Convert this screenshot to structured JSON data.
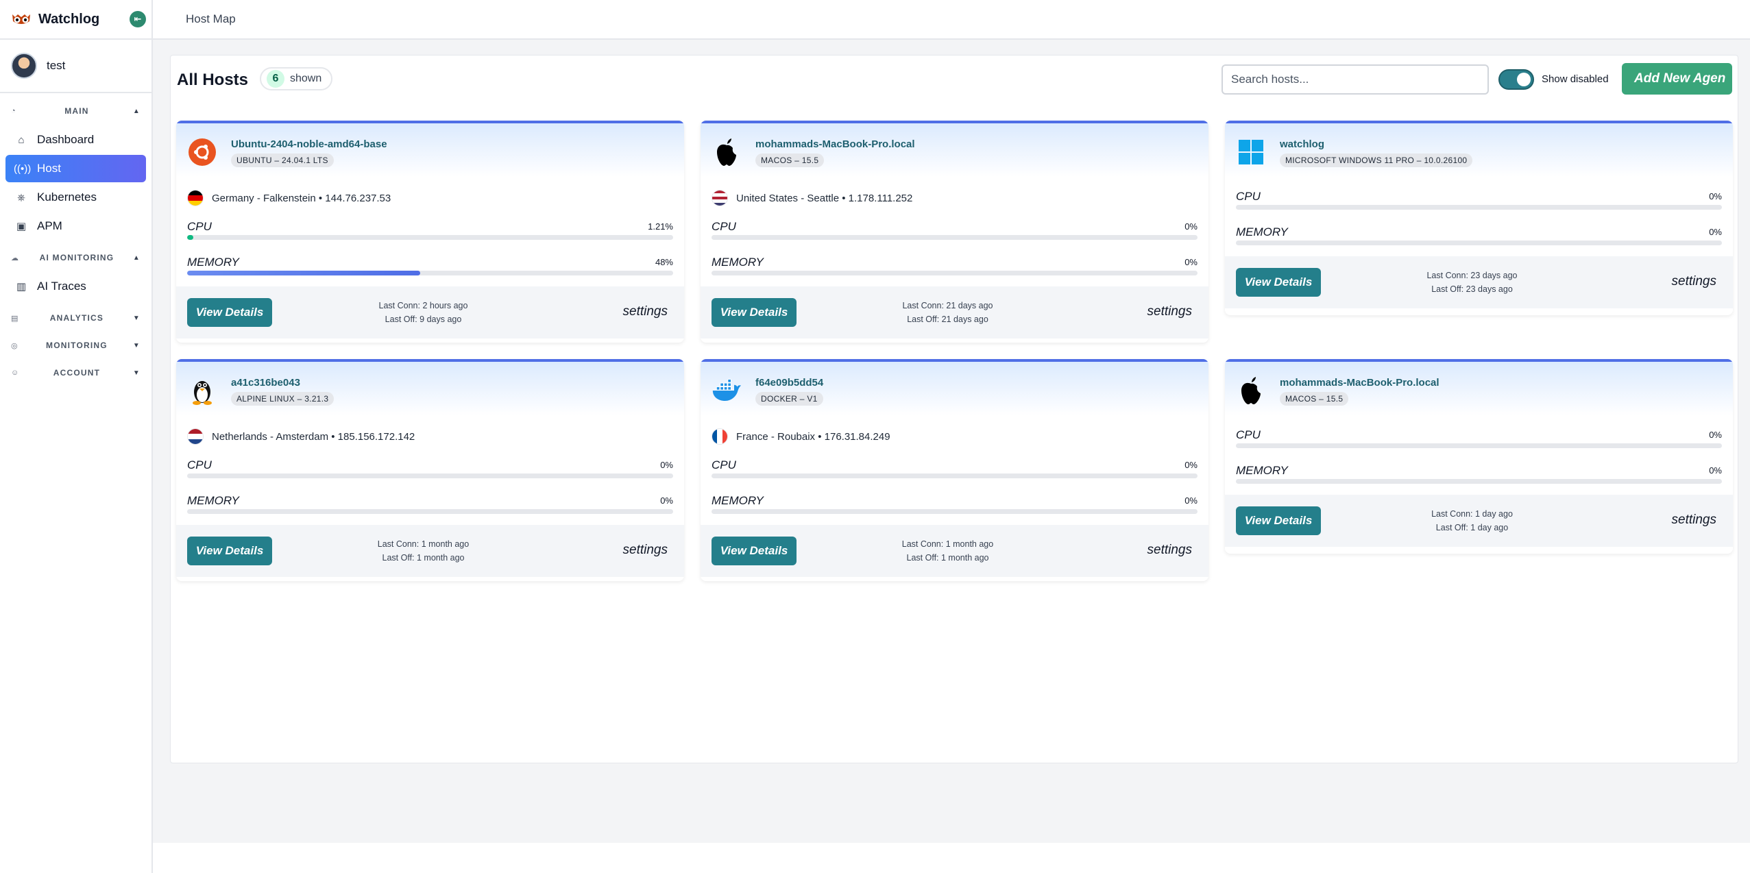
{
  "app": {
    "name": "Watchlog",
    "user": "test"
  },
  "sidebar": {
    "sections": [
      {
        "title": "MAIN",
        "items": [
          {
            "label": "Dashboard"
          },
          {
            "label": "Host"
          },
          {
            "label": "Kubernetes"
          },
          {
            "label": "APM"
          }
        ]
      },
      {
        "title": "AI MONITORING",
        "items": [
          {
            "label": "AI Traces"
          }
        ]
      },
      {
        "title": "ANALYTICS",
        "items": []
      },
      {
        "title": "MONITORING",
        "items": []
      },
      {
        "title": "ACCOUNT",
        "items": []
      }
    ],
    "active_item": "Host"
  },
  "header": {
    "breadcrumb": "Host Map"
  },
  "main": {
    "title": "All Hosts",
    "count": "6",
    "count_label": "shown",
    "search_placeholder": "Search hosts...",
    "toggle_label": "Show disabled",
    "toggle_on": true,
    "add_button": "Add New Agen"
  },
  "hosts": [
    {
      "name": "Ubuntu-2404-noble-amd64-base",
      "os": "UBUNTU – 24.04.1 LTS",
      "os_icon": "ubuntu-icon",
      "location": "Germany - Falkenstein • 144.76.237.53",
      "flag": "germany-flag",
      "cpu_label": "CPU",
      "cpu": "1.21%",
      "cpu_fraction": 0.0121,
      "mem_label": "MEMORY",
      "mem": "48%",
      "mem_fraction": 0.48,
      "view": "View Details",
      "last_conn": "Last Conn: 2 hours ago",
      "last_off": "Last Off: 9 days ago",
      "settings": "settings"
    },
    {
      "name": "mohammads-MacBook-Pro.local",
      "os": "MACOS – 15.5",
      "os_icon": "apple-icon",
      "location": "United States - Seattle • 1.178.111.252",
      "flag": "usa-flag",
      "cpu_label": "CPU",
      "cpu": "0%",
      "cpu_fraction": 0,
      "mem_label": "MEMORY",
      "mem": "0%",
      "mem_fraction": 0,
      "view": "View Details",
      "last_conn": "Last Conn: 21 days ago",
      "last_off": "Last Off: 21 days ago",
      "settings": "settings"
    },
    {
      "name": "watchlog",
      "os": "MICROSOFT WINDOWS 11 PRO – 10.0.26100",
      "os_icon": "windows-icon",
      "location": "",
      "flag": "",
      "cpu_label": "CPU",
      "cpu": "0%",
      "cpu_fraction": 0,
      "mem_label": "MEMORY",
      "mem": "0%",
      "mem_fraction": 0,
      "view": "View Details",
      "last_conn": "Last Conn: 23 days ago",
      "last_off": "Last Off: 23 days ago",
      "settings": "settings"
    },
    {
      "name": "a41c316be043",
      "os": "ALPINE LINUX – 3.21.3",
      "os_icon": "linux-tux-icon",
      "location": "Netherlands - Amsterdam • 185.156.172.142",
      "flag": "netherlands-flag",
      "cpu_label": "CPU",
      "cpu": "0%",
      "cpu_fraction": 0,
      "mem_label": "MEMORY",
      "mem": "0%",
      "mem_fraction": 0,
      "view": "View Details",
      "last_conn": "Last Conn: 1 month ago",
      "last_off": "Last Off: 1 month ago",
      "settings": "settings"
    },
    {
      "name": "f64e09b5dd54",
      "os": "DOCKER – V1",
      "os_icon": "docker-icon",
      "location": "France - Roubaix • 176.31.84.249",
      "flag": "france-flag",
      "cpu_label": "CPU",
      "cpu": "0%",
      "cpu_fraction": 0,
      "mem_label": "MEMORY",
      "mem": "0%",
      "mem_fraction": 0,
      "view": "View Details",
      "last_conn": "Last Conn: 1 month ago",
      "last_off": "Last Off: 1 month ago",
      "settings": "settings"
    },
    {
      "name": "mohammads-MacBook-Pro.local",
      "os": "MACOS – 15.5",
      "os_icon": "apple-icon",
      "location": "",
      "flag": "",
      "cpu_label": "CPU",
      "cpu": "0%",
      "cpu_fraction": 0,
      "mem_label": "MEMORY",
      "mem": "0%",
      "mem_fraction": 0,
      "view": "View Details",
      "last_conn": "Last Conn: 1 day ago",
      "last_off": "Last Off: 1 day ago",
      "settings": "settings"
    }
  ],
  "colors": {
    "accent": "#247f8b",
    "active_nav": "#4f6ee6",
    "add_button": "#3aa57a",
    "cpu_fill": "#10b981",
    "mem_fill": "#4f6ee6"
  }
}
